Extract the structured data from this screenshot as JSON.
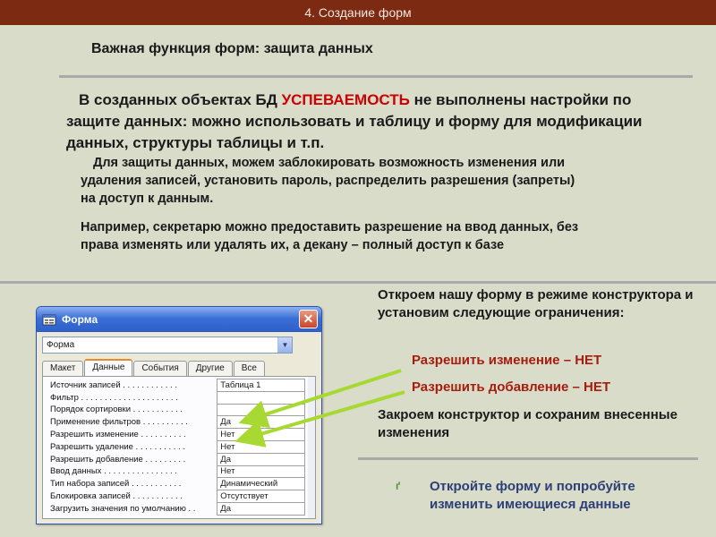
{
  "header": {
    "title": "4. Создание форм"
  },
  "slide": {
    "subtitle": "Важная функция форм: защита данных",
    "intro": {
      "before": "В созданных объектах БД ",
      "accent": "УСПЕВАЕМОСТЬ",
      "after": " не выполнены настройки по защите данных: можно использовать и таблицу и форму для модификации данных, структуры таблицы и т.п."
    },
    "protection": "Для защиты данных, можем заблокировать возможность изменения или удаления записей, установить пароль, распределить разрешения (запреты) на доступ к данным.",
    "example": "Например, секретарю можно предоставить разрешение на ввод данных, без права изменять или удалять их, а декану – полный доступ к базе",
    "open_form": "Откроем нашу форму в режиме конструктора и установим следующие ограничения:",
    "allow_edit": "Разрешить изменение – НЕТ",
    "allow_add": "Разрешить добавление – НЕТ",
    "close_designer": "Закроем конструктор и сохраним внесенные изменения",
    "try_it": "Откройте форму и попробуйте изменить имеющиеся данные",
    "bullet_mark": "ґ"
  },
  "window": {
    "title": "Форма",
    "close_label": "✕",
    "object_select": "Форма",
    "dropdown_arrow": "▼",
    "tabs": [
      {
        "label": "Макет",
        "active": false
      },
      {
        "label": "Данные",
        "active": true
      },
      {
        "label": "События",
        "active": false
      },
      {
        "label": "Другие",
        "active": false
      },
      {
        "label": "Все",
        "active": false
      }
    ],
    "properties": [
      {
        "name": "Источник записей . . . . . . . . . . . .",
        "value": "Таблица 1"
      },
      {
        "name": "Фильтр . . . . . . . . . . . . . . . . . . . . .",
        "value": ""
      },
      {
        "name": "Порядок сортировки . . . . . . . . . . .",
        "value": ""
      },
      {
        "name": "Применение фильтров . . . . . . . . . .",
        "value": "Да"
      },
      {
        "name": "Разрешить изменение . . . . . . . . . .",
        "value": "Нет"
      },
      {
        "name": "Разрешить удаление . . . . . . . . . . .",
        "value": "Нет"
      },
      {
        "name": "Разрешить добавление . . . . . . . . .",
        "value": "Да"
      },
      {
        "name": "Ввод данных . . . . . . . . . . . . . . . .",
        "value": "Нет"
      },
      {
        "name": "Тип набора записей . . . . . . . . . . .",
        "value": "Динамический"
      },
      {
        "name": "Блокировка записей . . . . . . . . . . .",
        "value": "Отсутствует"
      },
      {
        "name": "Загрузить значения по умолчанию . .",
        "value": "Да"
      }
    ]
  },
  "colors": {
    "header_bg": "#7c2a11",
    "accent_red": "#cc0000",
    "arrow_green": "#a8d832",
    "link_blue": "#2c3f77"
  }
}
